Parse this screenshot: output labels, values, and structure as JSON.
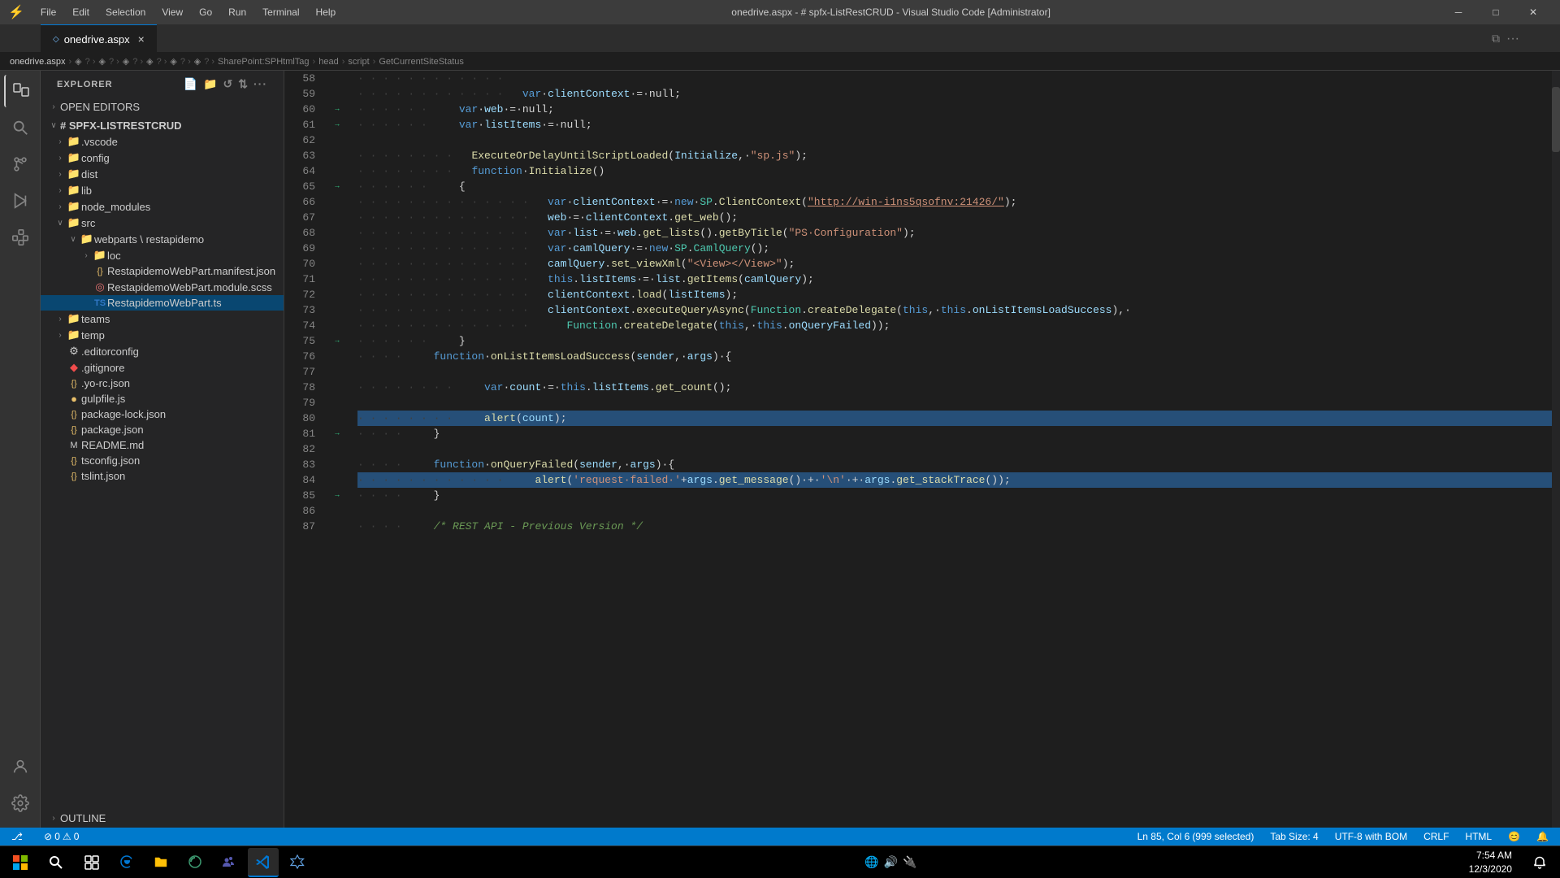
{
  "titleBar": {
    "logo": "⚡",
    "menuItems": [
      "File",
      "Edit",
      "Selection",
      "View",
      "Go",
      "Run",
      "Terminal",
      "Help"
    ],
    "windowTitle": "onedrive.aspx - # spfx-ListRestCRUD - Visual Studio Code [Administrator]",
    "minimizeBtn": "─",
    "maximizeBtn": "□",
    "closeBtn": "✕"
  },
  "tabBar": {
    "tabs": [
      {
        "label": "onedrive.aspx",
        "icon": "◇",
        "active": true,
        "closable": true
      }
    ]
  },
  "breadcrumb": {
    "items": [
      "onedrive.aspx",
      "?",
      "?",
      "?",
      "?",
      "?",
      "?",
      "SharePoint:SPHtmlTag",
      "head",
      "script",
      "GetCurrentSiteStatus"
    ]
  },
  "sidebar": {
    "header": "EXPLORER",
    "sections": [
      {
        "label": "OPEN EDITORS",
        "collapsed": true
      },
      {
        "label": "# SPFX-LISTRESTCRUD",
        "collapsed": false,
        "items": [
          {
            "type": "folder",
            "label": ".vscode",
            "indent": 1,
            "collapsed": true
          },
          {
            "type": "folder",
            "label": "config",
            "indent": 1,
            "collapsed": true
          },
          {
            "type": "folder",
            "label": "dist",
            "indent": 1,
            "collapsed": true
          },
          {
            "type": "folder",
            "label": "lib",
            "indent": 1,
            "collapsed": true
          },
          {
            "type": "folder",
            "label": "node_modules",
            "indent": 1,
            "collapsed": true
          },
          {
            "type": "folder",
            "label": "src",
            "indent": 1,
            "collapsed": false
          },
          {
            "type": "folder",
            "label": "webparts \\ restapidemo",
            "indent": 2,
            "collapsed": false
          },
          {
            "type": "folder",
            "label": "loc",
            "indent": 3,
            "collapsed": true
          },
          {
            "type": "file",
            "label": "RestapidemoWebPart.manifest.json",
            "indent": 3,
            "icon": "{}",
            "iconColor": "#e8bf6a"
          },
          {
            "type": "file",
            "label": "RestapidemoWebPart.module.scss",
            "indent": 3,
            "icon": "◎",
            "iconColor": "#e57373"
          },
          {
            "type": "file",
            "label": "RestapidemoWebPart.ts",
            "indent": 3,
            "icon": "TS",
            "iconColor": "#3178c6",
            "selected": true
          },
          {
            "type": "folder",
            "label": "teams",
            "indent": 1,
            "collapsed": true
          },
          {
            "type": "folder",
            "label": "temp",
            "indent": 1,
            "collapsed": true
          },
          {
            "type": "file",
            "label": ".editorconfig",
            "indent": 1,
            "icon": "⚙",
            "iconColor": "#cccccc"
          },
          {
            "type": "file",
            "label": ".gitignore",
            "indent": 1,
            "icon": "◆",
            "iconColor": "#f14c4c"
          },
          {
            "type": "file",
            "label": ".yo-rc.json",
            "indent": 1,
            "icon": "{}",
            "iconColor": "#e8bf6a"
          },
          {
            "type": "file",
            "label": "gulpfile.js",
            "indent": 1,
            "icon": "●",
            "iconColor": "#e8bf6a"
          },
          {
            "type": "file",
            "label": "package-lock.json",
            "indent": 1,
            "icon": "{}",
            "iconColor": "#e8bf6a"
          },
          {
            "type": "file",
            "label": "package.json",
            "indent": 1,
            "icon": "{}",
            "iconColor": "#e8bf6a"
          },
          {
            "type": "file",
            "label": "README.md",
            "indent": 1,
            "icon": "M",
            "iconColor": "#cccccc"
          },
          {
            "type": "file",
            "label": "tsconfig.json",
            "indent": 1,
            "icon": "{}",
            "iconColor": "#e8bf6a"
          },
          {
            "type": "file",
            "label": "tslint.json",
            "indent": 1,
            "icon": "{}",
            "iconColor": "#e8bf6a"
          }
        ]
      },
      {
        "label": "OUTLINE",
        "collapsed": true
      }
    ]
  },
  "codeLines": [
    {
      "num": 58,
      "content": "",
      "indent": 2,
      "raw": "                "
    },
    {
      "num": 59,
      "content": "var_clientContext_=_null;",
      "display": "            <kw>var</kw><plain> </plain><var>clientContext</var><plain> = null;</plain>"
    },
    {
      "num": 60,
      "content": "var_web_=_null;",
      "display": "            <kw>var</kw><plain> </plain><var>web</var><plain> = null;</plain>",
      "arrow": true
    },
    {
      "num": 61,
      "content": "var_listItems_=_null;",
      "display": "            <kw>var</kw><plain> </plain><var>listItems</var><plain> = null;</plain>",
      "arrow": true
    },
    {
      "num": 62,
      "content": ""
    },
    {
      "num": 63,
      "content": "ExecuteOrDelayUntilScriptLoaded",
      "display": "            <fn>ExecuteOrDelayUntilScriptLoaded</fn><plain>(</plain><var>Initialize</var><plain>, </plain><str>\"sp.js\"</str><plain>);</plain>"
    },
    {
      "num": 64,
      "content": "function Initialize()",
      "display": "            <kw>function</kw><plain> </plain><fn>Initialize</fn><plain>()</plain>"
    },
    {
      "num": 65,
      "content": "{",
      "display": "            <plain>{</plain>",
      "arrow": true
    },
    {
      "num": 66,
      "content": "var clientContext = new SP.ClientContext(...)",
      "display": "                <kw>var</kw><plain> </plain><var>clientContext</var><plain> = </plain><kw>new</kw><plain> </plain><type>SP</type><plain>.</plain><fn>ClientContext</fn><plain>(</plain><link>\"http://win-i1ns5qsofnv:21426/\"</link><plain>);</plain>"
    },
    {
      "num": 67,
      "content": "web = clientContext.get_web();",
      "display": "                <var>web</var><plain> = </plain><var>clientContext</var><plain>.</plain><fn>get_web</fn><plain>();</plain>"
    },
    {
      "num": 68,
      "content": "var list = web.get_lists().getByTitle()",
      "display": "                <kw>var</kw><plain> </plain><var>list</var><plain> = </plain><var>web</var><plain>.</plain><fn>get_lists</fn><plain>().</plain><fn>getByTitle</fn><plain>(</plain><str>\"PS·Configuration\"</str><plain>);</plain>"
    },
    {
      "num": 69,
      "content": "var camlQuery = new SP.CamlQuery();",
      "display": "                <kw>var</kw><plain> </plain><var>camlQuery</var><plain> = </plain><kw>new</kw><plain> </plain><type>SP</type><plain>.</plain><type>CamlQuery</type><plain>();</plain>"
    },
    {
      "num": 70,
      "content": "camlQuery.set_viewXml()",
      "display": "                <var>camlQuery</var><plain>.</plain><fn>set_viewXml</fn><plain>(</plain><str>\"&lt;View&gt;&lt;/View&gt;\"</str><plain>);</plain>"
    },
    {
      "num": 71,
      "content": "this.listItems = list.getItems(camlQuery);",
      "display": "                <kw>this</kw><plain>.</plain><var>listItems</var><plain> = </plain><var>list</var><plain>.</plain><fn>getItems</fn><plain>(</plain><var>camlQuery</var><plain>);</plain>"
    },
    {
      "num": 72,
      "content": "clientContext.load(listItems);",
      "display": "                <var>clientContext</var><plain>.</plain><fn>load</fn><plain>(</plain><var>listItems</var><plain>);</plain>"
    },
    {
      "num": 73,
      "content": "clientContext.executeQueryAsync(...)",
      "display": "                <var>clientContext</var><plain>.</plain><fn>executeQueryAsync</fn><plain>(</plain><type>Function</type><plain>.</plain><fn>createDelegate</fn><plain>(</plain><kw>this</kw><plain>, </plain><kw>this</kw><plain>.</plain><var>onListItemsLoadSuccess</var><plain>),·</plain>"
    },
    {
      "num": 74,
      "content": "Function.createDelegate(this, this.onQueryFailed));",
      "display": "                <type>Function</type><plain>.</plain><fn>createDelegate</fn><plain>(</plain><kw>this</kw><plain>, </plain><kw>this</kw><plain>.</plain><var>onQueryFailed</var><plain>));</plain>"
    },
    {
      "num": 75,
      "content": "}",
      "display": "            <plain>}</plain>",
      "arrow": true
    },
    {
      "num": 76,
      "content": "function onListItemsLoadSuccess(sender, args) {",
      "display": "        <kw>function</kw><plain> </plain><fn>onListItemsLoadSuccess</fn><plain>(</plain><var>sender</var><plain>, </plain><var>args</var><plain>) {</plain>"
    },
    {
      "num": 77,
      "content": ""
    },
    {
      "num": 78,
      "content": "var count = this.listItems.get_count();",
      "display": "            <kw>var</kw><plain> </plain><var>count</var><plain> = </plain><kw>this</kw><plain>.</plain><var>listItems</var><plain>.</plain><fn>get_count</fn><plain>();</plain>"
    },
    {
      "num": 79,
      "content": ""
    },
    {
      "num": 80,
      "content": "alert(count);",
      "display": "            <fn>alert</fn><plain>(</plain><var>count</var><plain>);</plain>",
      "highlighted": true
    },
    {
      "num": 81,
      "content": "}",
      "display": "        <plain>}</plain>",
      "arrow": true
    },
    {
      "num": 82,
      "content": ""
    },
    {
      "num": 83,
      "content": "function onQueryFailed(sender, args) {",
      "display": "        <kw>function</kw><plain> </plain><fn>onQueryFailed</fn><plain>(</plain><var>sender</var><plain>, </plain><var>args</var><plain>) {</plain>"
    },
    {
      "num": 84,
      "content": "alert('request failed' + args...)",
      "display": "            <fn>alert</fn><plain>(</plain><str>'request·failed·'</str><plain>+</plain><var>args</var><plain>.</plain><fn>get_message</fn><plain>()·+·</plain><str>'\\n'</str><plain>·+·</plain><var>args</var><plain>.</plain><fn>get_stackTrace</fn><plain>());</plain>",
      "highlighted": true
    },
    {
      "num": 85,
      "content": "}",
      "display": "        <plain>}</plain>",
      "arrow": true
    },
    {
      "num": 86,
      "content": ""
    },
    {
      "num": 87,
      "content": "/* REST API - Previous Version */",
      "display": "        <comment>/* REST API - Previous Version */</comment>"
    }
  ],
  "statusBar": {
    "errors": "0",
    "warnings": "0",
    "position": "Ln 85, Col 6",
    "selected": "(999 selected)",
    "tabSize": "Tab Size: 4",
    "encoding": "UTF-8 with BOM",
    "lineEnding": "CRLF",
    "language": "HTML",
    "feedbackIcon": "💬",
    "bellIcon": "🔔"
  },
  "taskbar": {
    "startLabel": "⊞",
    "searchPlaceholder": "🔍",
    "apps": [
      {
        "icon": "☰",
        "label": "Task View"
      },
      {
        "icon": "e",
        "label": "Edge"
      },
      {
        "icon": "📁",
        "label": "Explorer"
      },
      {
        "icon": "◈",
        "label": "Edge Dev"
      },
      {
        "icon": "⊕",
        "label": "Teams"
      },
      {
        "icon": "⚡",
        "label": "VS Code",
        "active": true
      },
      {
        "icon": "◇",
        "label": "Extension"
      }
    ],
    "time": "7:54 AM",
    "date": "12/3/2020"
  }
}
